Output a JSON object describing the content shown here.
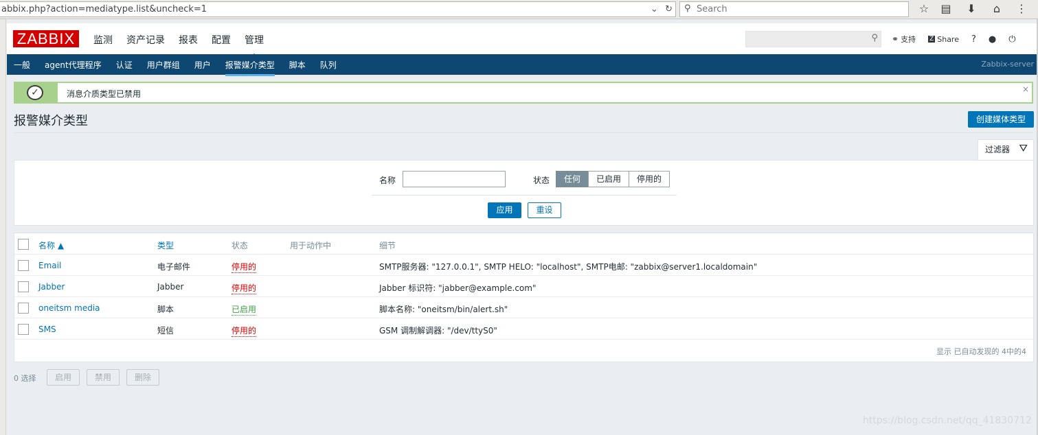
{
  "browser": {
    "url": "abbix.php?action=mediatype.list&uncheck=1",
    "search_placeholder": "Search"
  },
  "header": {
    "logo": "ZABBIX",
    "menu": [
      "监测",
      "资产记录",
      "报表",
      "配置",
      "管理"
    ],
    "tools": {
      "support": "支持",
      "share": "Share",
      "help": "?",
      "user": "",
      "logout": ""
    }
  },
  "subnav": {
    "items": [
      "一般",
      "agent代理程序",
      "认证",
      "用户群组",
      "用户",
      "报警媒介类型",
      "脚本",
      "队列"
    ],
    "server": "Zabbix-server"
  },
  "message": {
    "text": "消息介质类型已禁用",
    "close": "×"
  },
  "page": {
    "title": "报警媒介类型",
    "create_button": "创建媒体类型"
  },
  "filter": {
    "tab_label": "过滤器",
    "name_label": "名称",
    "name_value": "",
    "status_label": "状态",
    "status_options": [
      "任何",
      "已启用",
      "停用的"
    ],
    "status_selected": "任何",
    "apply": "应用",
    "reset": "重设"
  },
  "table": {
    "columns": {
      "name": "名称 ▲",
      "type": "类型",
      "status": "状态",
      "used": "用于动作中",
      "detail": "细节"
    },
    "rows": [
      {
        "name": "Email",
        "type": "电子邮件",
        "status": "停用的",
        "used": "",
        "detail": "SMTP服务器: \"127.0.0.1\", SMTP HELO: \"localhost\", SMTP电邮: \"zabbix@server1.localdomain\""
      },
      {
        "name": "Jabber",
        "type": "Jabber",
        "status": "停用的",
        "used": "",
        "detail": "Jabber 标识符: \"jabber@example.com\""
      },
      {
        "name": "oneitsm media",
        "type": "脚本",
        "status": "已启用",
        "used": "",
        "detail": "脚本名称: \"oneitsm/bin/alert.sh\""
      },
      {
        "name": "SMS",
        "type": "短信",
        "status": "停用的",
        "used": "",
        "detail": "GSM 调制解调器: \"/dev/ttyS0\""
      }
    ],
    "paging": "显示 已自动发现的 4中的4"
  },
  "footer": {
    "selected": "0 选择",
    "enable": "启用",
    "disable": "禁用",
    "delete": "删除"
  },
  "watermark": "https://blog.csdn.net/qq_41830712"
}
